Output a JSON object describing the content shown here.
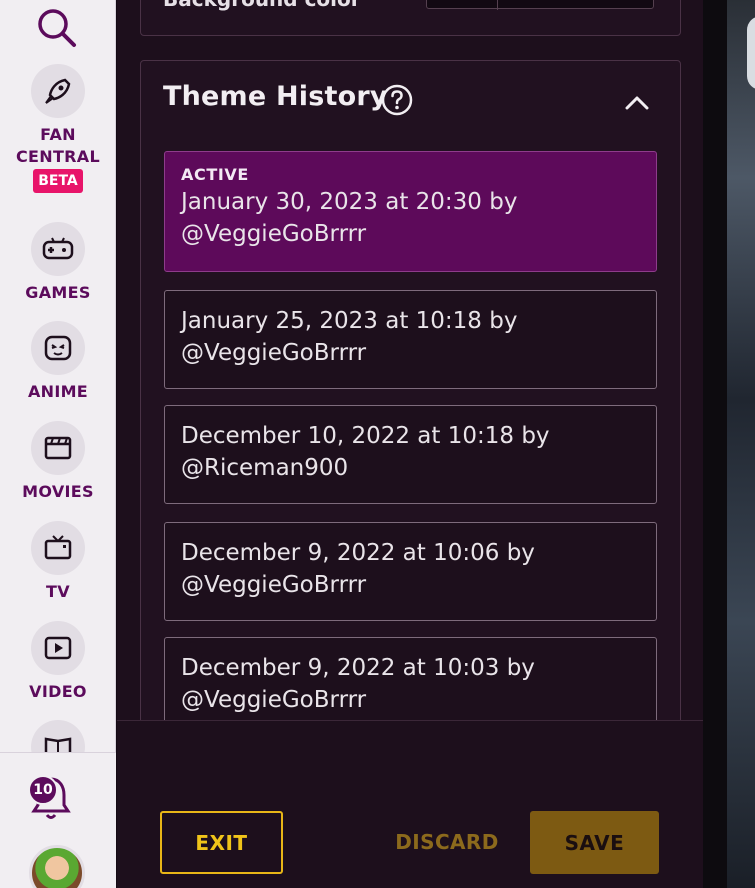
{
  "sidebar": {
    "items": [
      {
        "label_lines": [
          "FAN",
          "CENTRAL"
        ],
        "badge": "BETA",
        "icon": "rocket-icon"
      },
      {
        "label": "GAMES",
        "icon": "gamepad-icon"
      },
      {
        "label": "ANIME",
        "icon": "anime-face-icon"
      },
      {
        "label": "MOVIES",
        "icon": "clapperboard-icon"
      },
      {
        "label": "TV",
        "icon": "tv-icon"
      },
      {
        "label": "VIDEO",
        "icon": "play-icon"
      }
    ],
    "notifications_count": "10"
  },
  "top_card": {
    "clipped_label": "Background color"
  },
  "theme_history": {
    "title": "Theme History",
    "active_label": "ACTIVE",
    "entries": [
      {
        "line1": "January 30, 2023 at 20:30 by",
        "line2": "@VeggieGoBrrrr",
        "active": true
      },
      {
        "line1": "January 25, 2023 at 10:18 by",
        "line2": "@VeggieGoBrrrr"
      },
      {
        "line1": "December 10, 2022 at 10:18 by",
        "line2": "@Riceman900"
      },
      {
        "line1": "December 9, 2022 at 10:06 by",
        "line2": "@VeggieGoBrrrr"
      },
      {
        "line1": "December 9, 2022 at 10:03 by",
        "line2": "@VeggieGoBrrrr"
      }
    ]
  },
  "footer": {
    "exit_label": "EXIT",
    "discard_label": "DISCARD",
    "save_label": "SAVE"
  },
  "colors": {
    "accent": "#5d0a5a",
    "gold": "#e8b617",
    "nav_text": "#5c0b5c",
    "beta": "#e8146a"
  }
}
